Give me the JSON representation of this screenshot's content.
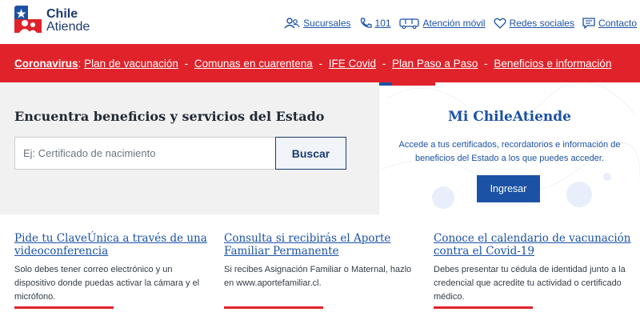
{
  "logo": {
    "line1": "Chile",
    "line2": "Atiende"
  },
  "topnav": [
    {
      "label": "Sucursales",
      "icon": "people-icon"
    },
    {
      "label": "101",
      "icon": "phone-icon"
    },
    {
      "label": "Atención móvil",
      "icon": "bus-icon"
    },
    {
      "label": "Redes sociales",
      "icon": "heart-icon"
    },
    {
      "label": "Contacto",
      "icon": "chat-icon"
    }
  ],
  "alert": {
    "prefix": "Coronavirus",
    "colon": ":",
    "links": [
      "Plan de vacunación",
      "Comunas en cuarentena",
      "IFE Covid",
      "Plan Paso a Paso",
      "Beneficios e información"
    ],
    "separator": " - "
  },
  "search": {
    "title": "Encuentra beneficios y servicios del Estado",
    "placeholder": "Ej: Certificado de nacimiento",
    "button": "Buscar"
  },
  "card": {
    "title": "Mi ChileAtiende",
    "description": "Accede a tus certificados, recordatorios e información de beneficios del Estado a los que puedes acceder.",
    "button": "Ingresar"
  },
  "columns": [
    {
      "title": "Pide tu ClaveÚnica a través de una videoconferencia",
      "text": "Solo debes tener correo electrónico y un dispositivo donde puedas activar la cámara y el micrófono."
    },
    {
      "title": "Consulta si recibirás el Aporte Familiar Permanente",
      "text": "Si recibes Asignación Familiar o Maternal, hazlo en www.aportefamiliar.cl."
    },
    {
      "title": "Conoce el calendario de vacunación contra el Covid-19",
      "text": "Debes presentar tu cédula de identidad junto a la credencial que acredite tu actividad o certificado médico."
    }
  ],
  "colors": {
    "brand_blue": "#1b52a5",
    "brand_red": "#e0232b",
    "navy": "#1b3b6f"
  }
}
